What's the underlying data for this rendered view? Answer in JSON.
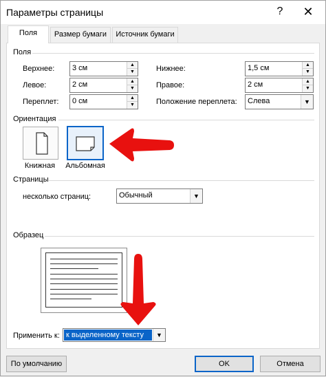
{
  "window": {
    "title": "Параметры страницы",
    "help": "?",
    "close": "✕"
  },
  "tabs": [
    {
      "label": "Поля"
    },
    {
      "label": "Размер бумаги"
    },
    {
      "label": "Источник бумаги"
    }
  ],
  "margins": {
    "section": "Поля",
    "top": {
      "label": "Верхнее:",
      "value": "3 см"
    },
    "bottom": {
      "label": "Нижнее:",
      "value": "1,5 см"
    },
    "left": {
      "label": "Левое:",
      "value": "2 см"
    },
    "right": {
      "label": "Правое:",
      "value": "2 см"
    },
    "gutter": {
      "label": "Переплет:",
      "value": "0 см"
    },
    "gutter_position": {
      "label": "Положение переплета:",
      "value": "Слева"
    }
  },
  "orientation": {
    "section": "Ориентация",
    "portrait": "Книжная",
    "landscape": "Альбомная",
    "selected": "landscape"
  },
  "pages": {
    "section": "Страницы",
    "multiple_label": "несколько страниц:",
    "multiple_value": "Обычный"
  },
  "preview": {
    "section": "Образец"
  },
  "apply": {
    "label": "Применить к:",
    "value": "к выделенному тексту"
  },
  "buttons": {
    "default": "По умолчанию",
    "ok": "OK",
    "cancel": "Отмена"
  },
  "annotations": {
    "arrow_color": "#e8110f"
  },
  "colors": {
    "selection": "#0a64c8"
  }
}
